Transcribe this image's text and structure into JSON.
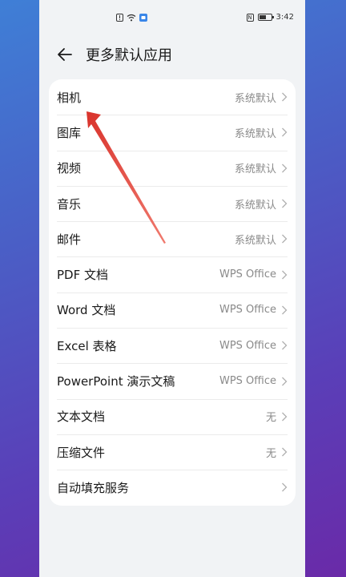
{
  "status_bar": {
    "time": "3:42"
  },
  "header": {
    "title": "更多默认应用"
  },
  "settings": {
    "items": [
      {
        "label": "相机",
        "value": "系统默认"
      },
      {
        "label": "图库",
        "value": "系统默认"
      },
      {
        "label": "视频",
        "value": "系统默认"
      },
      {
        "label": "音乐",
        "value": "系统默认"
      },
      {
        "label": "邮件",
        "value": "系统默认"
      },
      {
        "label": "PDF 文档",
        "value": "WPS Office"
      },
      {
        "label": "Word 文档",
        "value": "WPS Office"
      },
      {
        "label": "Excel 表格",
        "value": "WPS Office"
      },
      {
        "label": "PowerPoint 演示文稿",
        "value": "WPS Office"
      },
      {
        "label": "文本文档",
        "value": "无"
      },
      {
        "label": "压缩文件",
        "value": "无"
      },
      {
        "label": "自动填充服务",
        "value": ""
      }
    ]
  },
  "colors": {
    "annotation_arrow": "#e0443c",
    "screen_background": "#f1f3f5",
    "card_background": "#ffffff"
  }
}
